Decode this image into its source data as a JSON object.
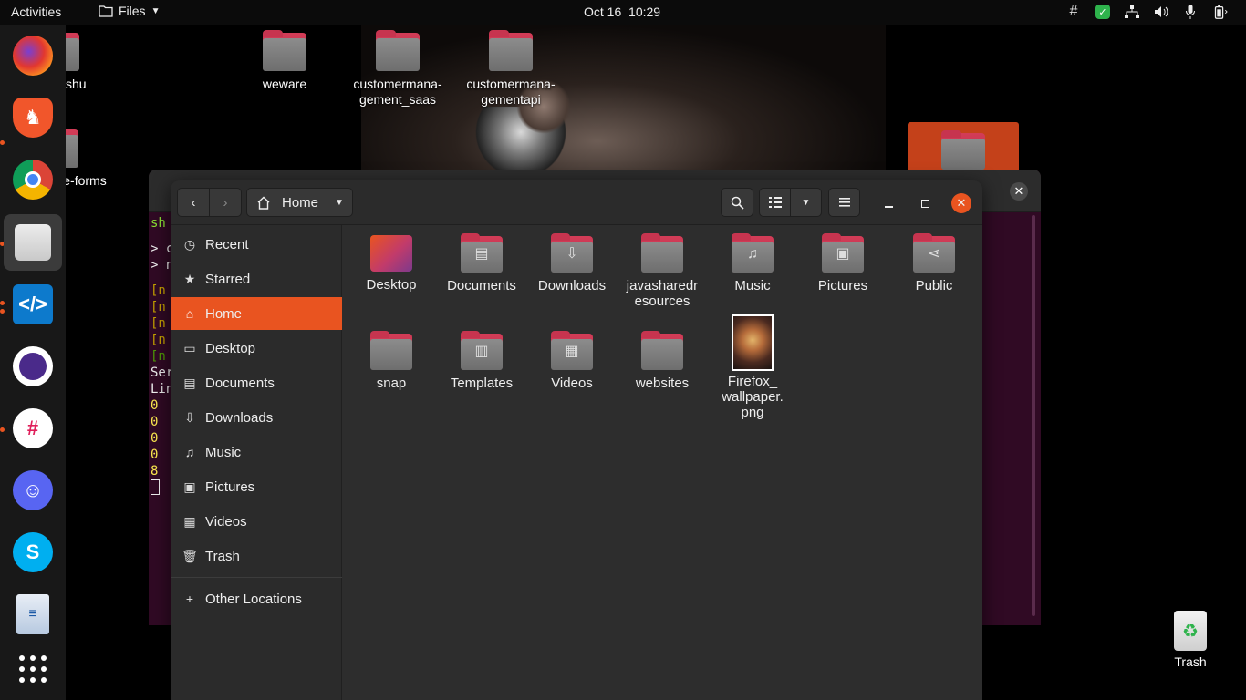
{
  "topbar": {
    "activities": "Activities",
    "app_name": "Files",
    "date": "Oct 16",
    "time": "10:29",
    "tray_icons": [
      "slack-tray-icon",
      "shield-tray-icon",
      "network-icon",
      "volume-icon",
      "microphone-icon",
      "battery-icon"
    ]
  },
  "desktop": {
    "icons": [
      {
        "label": "shivanshu"
      },
      {
        "label": "weware"
      },
      {
        "label": "customermana-gement_saas"
      },
      {
        "label": "customermana-gementapi"
      },
      {
        "label": "e-forms"
      }
    ],
    "trash_label": "Trash"
  },
  "dock": {
    "apps": [
      "firefox-icon",
      "brave-icon",
      "chrome-icon",
      "files-icon",
      "vscode-icon",
      "tor-icon",
      "slack-icon",
      "discord-icon",
      "skype-icon",
      "writer-icon",
      "app-grid-icon"
    ]
  },
  "terminal": {
    "lines": [
      "sh",
      "> c",
      "> n",
      "[n",
      "[n",
      "[n",
      "[n",
      "[n",
      "Ser",
      "Lin",
      "0",
      "0",
      "0",
      "0",
      "8"
    ]
  },
  "files": {
    "path_label": "Home",
    "sidebar": [
      {
        "label": "Recent",
        "icon": "clock-icon"
      },
      {
        "label": "Starred",
        "icon": "star-icon"
      },
      {
        "label": "Home",
        "icon": "home-icon"
      },
      {
        "label": "Desktop",
        "icon": "desktop-icon"
      },
      {
        "label": "Documents",
        "icon": "document-icon"
      },
      {
        "label": "Downloads",
        "icon": "download-icon"
      },
      {
        "label": "Music",
        "icon": "music-icon"
      },
      {
        "label": "Pictures",
        "icon": "picture-icon"
      },
      {
        "label": "Videos",
        "icon": "video-icon"
      },
      {
        "label": "Trash",
        "icon": "trash-icon"
      }
    ],
    "other_locations": "Other Locations",
    "items": [
      {
        "label": "Desktop"
      },
      {
        "label": "Documents"
      },
      {
        "label": "Downloads"
      },
      {
        "label": "javasharedr esources"
      },
      {
        "label": "Music"
      },
      {
        "label": "Pictures"
      },
      {
        "label": "Public"
      },
      {
        "label": "snap"
      },
      {
        "label": "Templates"
      },
      {
        "label": "Videos"
      },
      {
        "label": "websites"
      },
      {
        "label": "Firefox_ wallpaper. png"
      }
    ],
    "colors": {
      "accent": "#e95420",
      "close": "#e95420"
    }
  }
}
